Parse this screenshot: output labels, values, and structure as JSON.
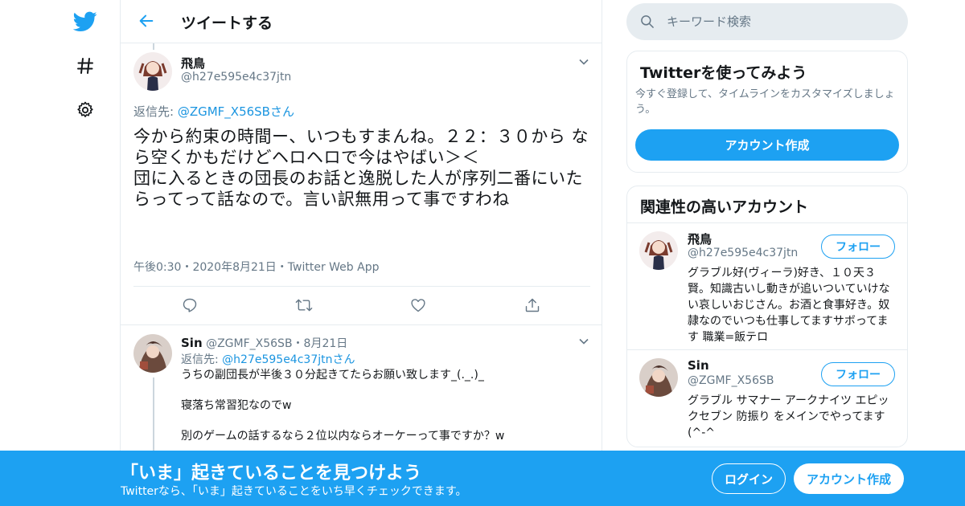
{
  "app": {
    "brand_color": "#1da1f2",
    "logo_icon": "twitter-bird-icon"
  },
  "nav": {
    "items": [
      {
        "icon": "twitter-bird-icon"
      },
      {
        "icon": "hashtag-icon"
      },
      {
        "icon": "gear-icon"
      }
    ]
  },
  "header": {
    "title": "ツイートする"
  },
  "main_tweet": {
    "name": "飛鳥",
    "handle": "@h27e595e4c37jtn",
    "reply_prefix": "返信先: ",
    "reply_user": "@ZGMF_X56SB",
    "reply_suffix": "さん",
    "text": "今から約束の時間ー、いつもすまんね。２２：３０から なら空くかもだけどヘロヘロで今はやばい＞＜\n団に入るときの団長のお話と逸脱した人が序列二番にいたらってって話なので。言い訳無用って事ですわね",
    "meta": "午後0:30・2020年8月21日・Twitter Web App"
  },
  "reply_tweet": {
    "name": "Sin",
    "handle": "@ZGMF_X56SB",
    "date": "・8月21日",
    "reply_prefix": "返信先: ",
    "reply_user": "@h27e595e4c37jtn",
    "reply_suffix": "さん",
    "text": "うちの副団長が半後３０分起きてたらお願い致します_(._.)_\n\n寝落ち常習犯なのでw\n\n別のゲームの話するなら２位以内ならオーケーって事ですか？w"
  },
  "search": {
    "placeholder": "キーワード検索"
  },
  "signup_card": {
    "title": "Twitterを使ってみよう",
    "desc": "今すぐ登録して、タイムラインをカスタマイズしましょう。",
    "button": "アカウント作成"
  },
  "related": {
    "title": "関連性の高いアカウント",
    "accounts": [
      {
        "name": "飛鳥",
        "handle": "@h27e595e4c37jtn",
        "follow": "フォロー",
        "bio": "グラブル好(ヴィーラ)好き、１０天３賢。知識古いし動きが追いついていけない哀しいおじさん。お酒と食事好き。奴隷なのでいつも仕事してますサボってます 職業=飯テロ"
      },
      {
        "name": "Sin",
        "handle": "@ZGMF_X56SB",
        "follow": "フォロー",
        "bio": "グラブル サマナー アークナイツ エピックセブン 防振り をメインでやってます(^-^"
      }
    ]
  },
  "banner": {
    "title": "「いま」起きていることを見つけよう",
    "subtitle": "Twitterなら、「いま」起きていることをいち早くチェックできます。",
    "login": "ログイン",
    "signup": "アカウント作成"
  }
}
